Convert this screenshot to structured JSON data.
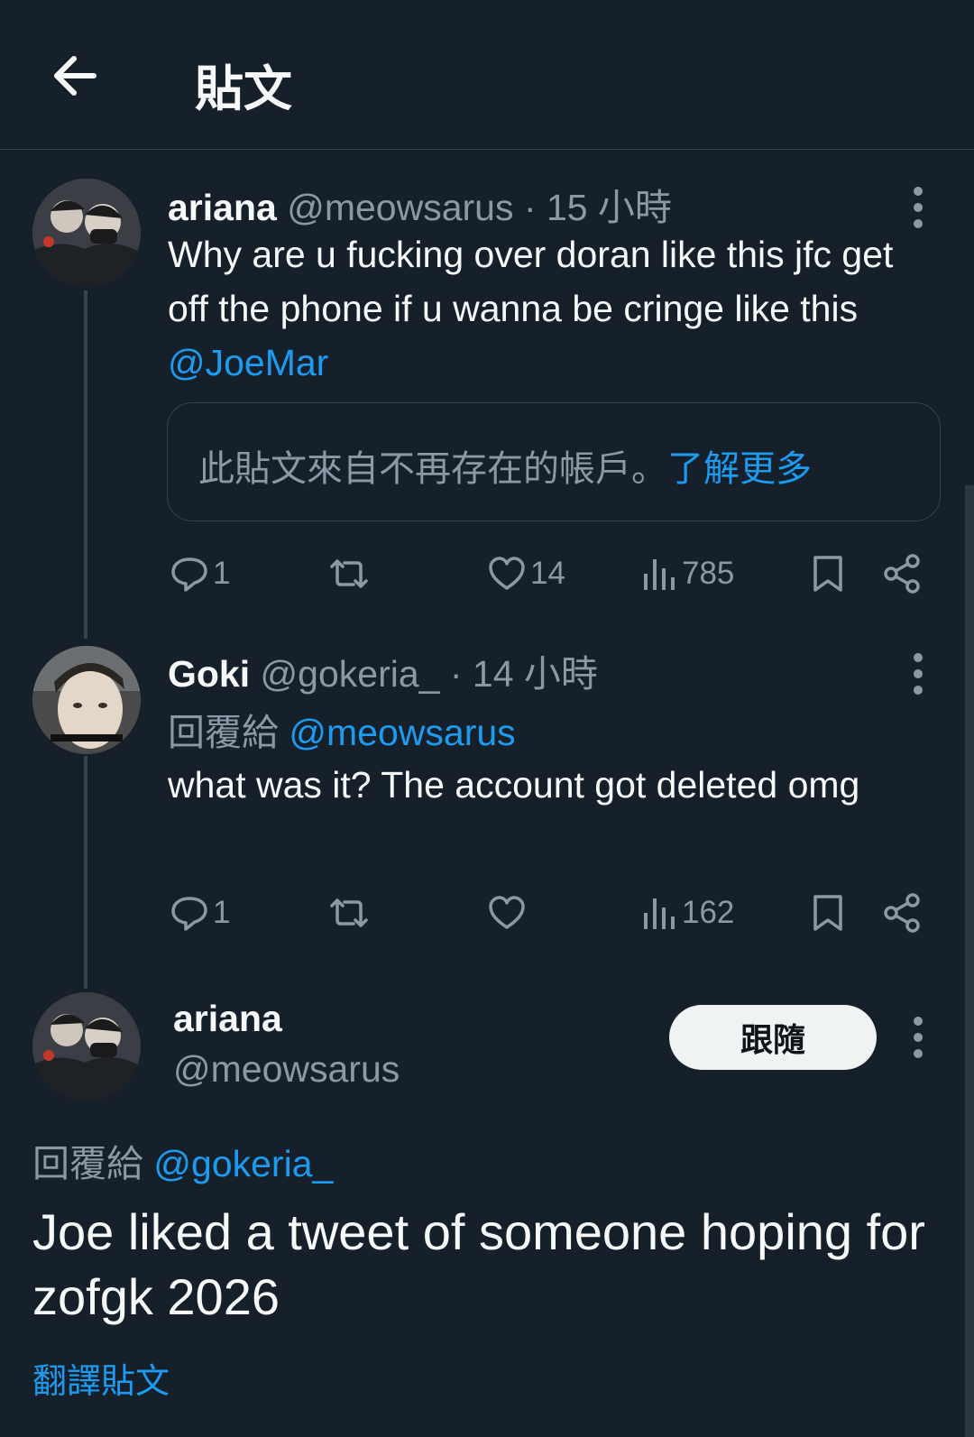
{
  "header": {
    "title": "貼文"
  },
  "tweets": [
    {
      "name": "ariana",
      "handle": "@meowsarus",
      "dot": "·",
      "time": "15 小時",
      "text": "Why are u fucking over doran like this jfc get off the phone if u wanna be cringe like this ",
      "mention": "@JoeMar",
      "notice": "此貼文來自不再存在的帳戶。",
      "notice_link": "了解更多",
      "replies": "1",
      "likes": "14",
      "views": "785"
    },
    {
      "name": "Goki",
      "handle": "@gokeria_",
      "dot": "·",
      "time": "14 小時",
      "replying_label": "回覆給",
      "replying_to": "@meowsarus",
      "text": "what was it? The account got deleted omg",
      "replies": "1",
      "views": "162"
    }
  ],
  "main": {
    "name": "ariana",
    "handle": "@meowsarus",
    "follow_label": "跟隨",
    "replying_label": "回覆給",
    "replying_to": "@gokeria_",
    "text": "Joe liked a tweet of someone hoping for zofgk 2026",
    "translate_label": "翻譯貼文"
  },
  "icons": {
    "back": "arrow-left-icon",
    "more": "more-vertical-icon",
    "reply": "reply-icon",
    "retweet": "retweet-icon",
    "like": "heart-icon",
    "views": "views-icon",
    "bookmark": "bookmark-icon",
    "share": "share-icon"
  },
  "colors": {
    "background": "#15202b",
    "accent": "#1d9bf0",
    "secondary_text": "#8b98a5",
    "border": "#38444d"
  }
}
